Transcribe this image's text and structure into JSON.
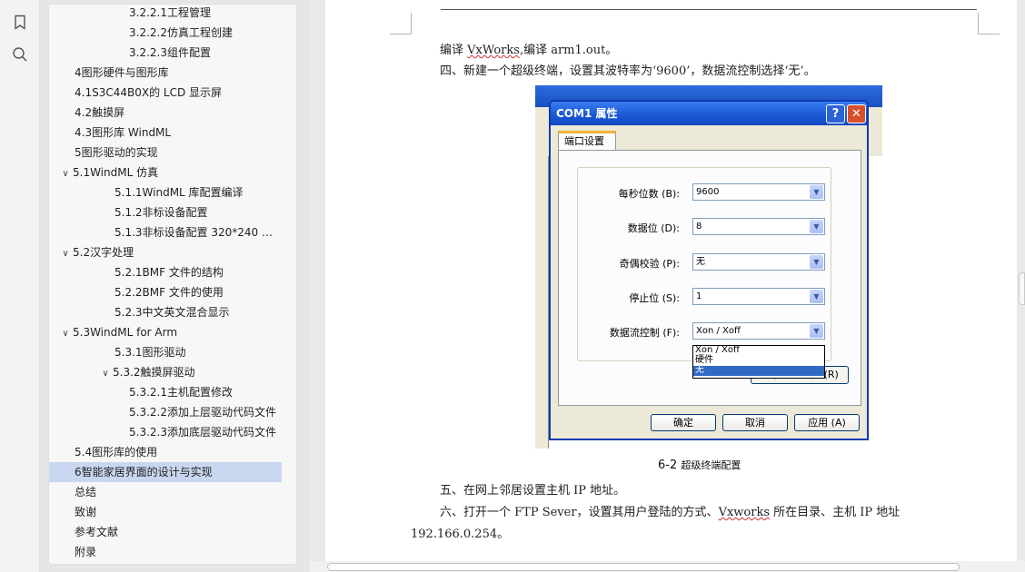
{
  "sidebar_icons": [
    {
      "name": "bookmark-icon"
    },
    {
      "name": "search-icon"
    }
  ],
  "outline": {
    "items": [
      {
        "label": "3.2.2.1工程管理",
        "level": 3,
        "chevron": ""
      },
      {
        "label": "3.2.2.2仿真工程创建",
        "level": 3,
        "chevron": ""
      },
      {
        "label": "3.2.2.3组件配置",
        "level": 3,
        "chevron": ""
      },
      {
        "label": "4图形硬件与图形库",
        "level": 0,
        "chevron": ""
      },
      {
        "label": "4.1S3C44B0X的 LCD 显示屏",
        "level": 0,
        "chevron": ""
      },
      {
        "label": "4.2触摸屏",
        "level": 0,
        "chevron": ""
      },
      {
        "label": "4.3图形库 WindML",
        "level": 0,
        "chevron": ""
      },
      {
        "label": "5图形驱动的实现",
        "level": 0,
        "chevron": ""
      },
      {
        "label": "5.1WindML 仿真",
        "level": 0,
        "chevron": "∨"
      },
      {
        "label": "5.1.1WindML 库配置编译",
        "level": 2,
        "chevron": ""
      },
      {
        "label": "5.1.2非标设备配置",
        "level": 2,
        "chevron": ""
      },
      {
        "label": "5.1.3非标设备配置 320*240 彩...",
        "level": 2,
        "chevron": ""
      },
      {
        "label": "5.2汉字处理",
        "level": 0,
        "chevron": "∨"
      },
      {
        "label": "5.2.1BMF 文件的结构",
        "level": 2,
        "chevron": ""
      },
      {
        "label": "5.2.2BMF 文件的使用",
        "level": 2,
        "chevron": ""
      },
      {
        "label": "5.2.3中文英文混合显示",
        "level": 2,
        "chevron": ""
      },
      {
        "label": "5.3WindML for Arm",
        "level": 0,
        "chevron": "∨"
      },
      {
        "label": "5.3.1图形驱动",
        "level": 2,
        "chevron": ""
      },
      {
        "label": "5.3.2触摸屏驱动",
        "level": 2,
        "chevron": "∨"
      },
      {
        "label": "5.3.2.1主机配置修改",
        "level": 3,
        "chevron": ""
      },
      {
        "label": "5.3.2.2添加上层驱动代码文件",
        "level": 3,
        "chevron": ""
      },
      {
        "label": "5.3.2.3添加底层驱动代码文件",
        "level": 3,
        "chevron": ""
      },
      {
        "label": "5.4图形库的使用",
        "level": 0,
        "chevron": ""
      },
      {
        "label": "6智能家居界面的设计与实现",
        "level": 0,
        "chevron": "",
        "active": true
      },
      {
        "label": "总结",
        "level": 0,
        "chevron": ""
      },
      {
        "label": "致谢",
        "level": 0,
        "chevron": ""
      },
      {
        "label": "参考文献",
        "level": 0,
        "chevron": ""
      },
      {
        "label": "附录",
        "level": 0,
        "chevron": ""
      }
    ]
  },
  "document": {
    "line1": {
      "a": "编译 ",
      "b": "VxWorks",
      "c": ",编译 arm1.out。"
    },
    "line2": "四、新建一个超级终端，设置其波特率为‘9600’，数据流控制选择‘无’。",
    "caption_num": "6-2",
    "caption_text": "超级终端配置",
    "line5": "五、在网上邻居设置主机 IP 地址。",
    "line6": {
      "a": "六、打开一个 FTP Sever，设置其用户登陆的方式、",
      "b": "Vxworks",
      "c": " 所在目录、主机 IP 地址"
    },
    "line7": "192.166.0.254。"
  },
  "dialog": {
    "title": "COM1 属性",
    "help": "?",
    "close": "✕",
    "tab": "端口设置",
    "fields": [
      {
        "label": "每秒位数 (B):",
        "value": "9600"
      },
      {
        "label": "数据位 (D):",
        "value": "8"
      },
      {
        "label": "奇偶校验 (P):",
        "value": "无"
      },
      {
        "label": "停止位 (S):",
        "value": "1"
      },
      {
        "label": "数据流控制 (F):",
        "value": "Xon / Xoff"
      }
    ],
    "dropdown_options": [
      "Xon / Xoff",
      "硬件",
      "无"
    ],
    "restore_button": "还原为默认值 (R)",
    "ok_button": "确定",
    "cancel_button": "取消",
    "apply_button": "应用 (A)"
  }
}
